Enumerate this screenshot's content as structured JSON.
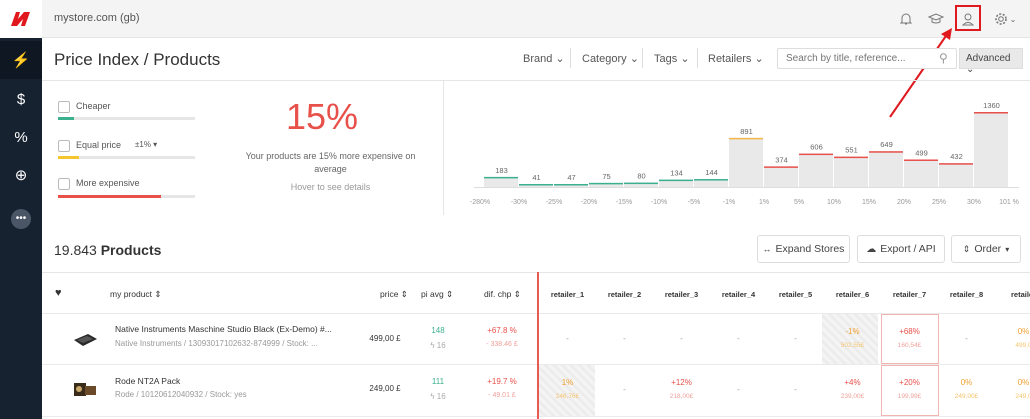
{
  "app": {
    "store_name": "mystore.com (gb)"
  },
  "sidebar": {
    "items": [
      {
        "icon": "bolt-icon",
        "glyph": "⚡"
      },
      {
        "icon": "dollar-icon",
        "glyph": "$"
      },
      {
        "icon": "percent-icon",
        "glyph": "%"
      },
      {
        "icon": "globe-icon",
        "glyph": "⊕"
      },
      {
        "icon": "more-icon",
        "glyph": "•••"
      }
    ]
  },
  "header": {
    "title": "Price Index / Products",
    "filters": [
      "Brand",
      "Category",
      "Tags",
      "Retailers"
    ],
    "search_placeholder": "Search by title, reference...",
    "advanced_label": "Advanced"
  },
  "summary": {
    "cheaper_label": "Cheaper",
    "equal_label": "Equal price",
    "equal_tolerance": "±1%",
    "expensive_label": "More expensive",
    "cheaper_share": 0.12,
    "equal_share": 0.15,
    "expensive_share": 0.75,
    "big_percent": "15%",
    "description": "Your products are 15% more expensive on average",
    "hover_hint": "Hover to see details"
  },
  "chart_data": {
    "type": "bar",
    "categories": [
      "-280%",
      "-30%",
      "-25%",
      "-20%",
      "-15%",
      "-10%",
      "-5%",
      "-1%",
      "1%",
      "5%",
      "10%",
      "15%",
      "20%",
      "25%",
      "30%",
      "101 %"
    ],
    "x_ticks": [
      "-280%",
      "-30%",
      "-25%",
      "-20%",
      "-15%",
      "-10%",
      "-5%",
      "-1%",
      "1%",
      "5%",
      "10%",
      "15%",
      "20%",
      "25%",
      "30%",
      "101 %"
    ],
    "values": [
      183,
      41,
      47,
      75,
      80,
      134,
      144,
      891,
      374,
      606,
      551,
      649,
      499,
      432,
      1360
    ],
    "colors": [
      "#3bb08f",
      "#3bb08f",
      "#3bb08f",
      "#3bb08f",
      "#3bb08f",
      "#3bb08f",
      "#3bb08f",
      "#f5b74a",
      "#e8504a",
      "#e8504a",
      "#e8504a",
      "#e8504a",
      "#e8504a",
      "#e8504a",
      "#e8504a"
    ],
    "ylim": [
      0,
      1360
    ]
  },
  "products": {
    "count": "19.843",
    "label": "Products",
    "expand_label": "Expand Stores",
    "export_label": "Export / API",
    "order_label": "Order"
  },
  "table": {
    "headers": {
      "my_product": "my product",
      "price": "price",
      "pi_avg": "pi avg",
      "dif_chp": "dif. chp"
    },
    "retailers": [
      "retailer_1",
      "retailer_2",
      "retailer_3",
      "retailer_4",
      "retailer_5",
      "retailer_6",
      "retailer_7",
      "retailer_8",
      "retailer"
    ],
    "rows": [
      {
        "title": "Native Instruments Maschine Studio Black (Ex-Demo) #...",
        "subtitle": "Native Instruments / 13093017102632-874999 / Stock: ...",
        "price": "499,00 £",
        "pi": "148",
        "pi_sub": "16",
        "dif": "+67.8 %",
        "dif_sub": "- 338.46 £",
        "cells": [
          {
            "v": "-",
            "s": ""
          },
          {
            "v": "-",
            "s": ""
          },
          {
            "v": "-",
            "s": ""
          },
          {
            "v": "-",
            "s": ""
          },
          {
            "v": "-",
            "s": ""
          },
          {
            "v": "-1%",
            "s": "502,55£"
          },
          {
            "v": "+68%",
            "s": "160,54£"
          },
          {
            "v": "-",
            "s": ""
          },
          {
            "v": "0%",
            "s": "499,0"
          }
        ]
      },
      {
        "title": "Rode NT2A Pack",
        "subtitle": "Rode / 1012061204093​2 / Stock: yes",
        "price": "249,00 £",
        "pi": "111",
        "pi_sub": "16",
        "dif": "+19.7 %",
        "dif_sub": "- 49.01 £",
        "cells": [
          {
            "v": "1%",
            "s": "246,76£"
          },
          {
            "v": "-",
            "s": ""
          },
          {
            "v": "+12%",
            "s": "218,00£"
          },
          {
            "v": "-",
            "s": ""
          },
          {
            "v": "-",
            "s": ""
          },
          {
            "v": "+4%",
            "s": "239,00£"
          },
          {
            "v": "+20%",
            "s": "199,99£"
          },
          {
            "v": "0%",
            "s": "249,00£"
          },
          {
            "v": "0%",
            "s": "249,0"
          }
        ]
      }
    ]
  }
}
